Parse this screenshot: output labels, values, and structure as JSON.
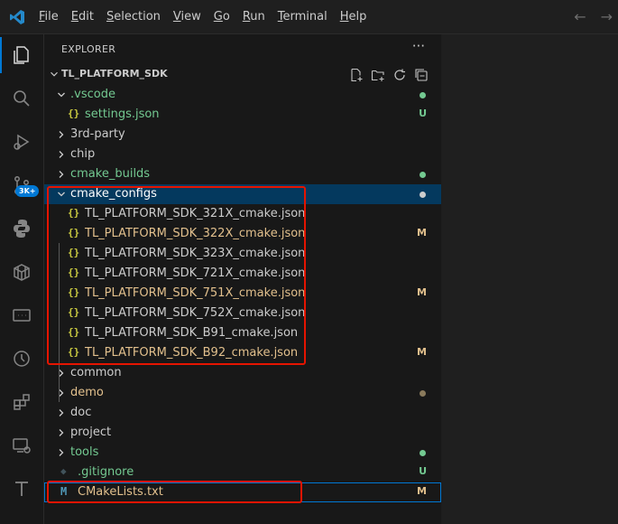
{
  "menu": [
    {
      "first": "F",
      "rest": "ile"
    },
    {
      "first": "E",
      "rest": "dit"
    },
    {
      "first": "S",
      "rest": "election"
    },
    {
      "first": "V",
      "rest": "iew"
    },
    {
      "first": "G",
      "rest": "o"
    },
    {
      "first": "R",
      "rest": "un"
    },
    {
      "first": "T",
      "rest": "erminal"
    },
    {
      "first": "H",
      "rest": "elp"
    }
  ],
  "nav": {
    "back": "←",
    "forward": "→"
  },
  "activity_bar": {
    "items": [
      "explorer-icon",
      "search-icon",
      "run-debug-icon",
      "source-control-icon",
      "python-icon",
      "package-icon",
      "remote-icon",
      "timeline-icon",
      "extensions-icon",
      "remote-explorer-icon",
      "text-icon"
    ],
    "badge": "3K+"
  },
  "explorer": {
    "header": "EXPLORER",
    "more": "···",
    "root": "TL_PLATFORM_SDK",
    "rows": [
      {
        "label": ".vscode",
        "type": "folder",
        "open": true,
        "indent": 0,
        "color": "#73c991",
        "decoration": "dot",
        "decoColor": "#73c991"
      },
      {
        "label": "settings.json",
        "type": "json",
        "indent": 1,
        "color": "#73c991",
        "decoration": "U",
        "decoColor": "#73c991"
      },
      {
        "label": "3rd-party",
        "type": "folder",
        "open": false,
        "indent": 0,
        "color": "#cccccc"
      },
      {
        "label": "chip",
        "type": "folder",
        "open": false,
        "indent": 0,
        "color": "#cccccc"
      },
      {
        "label": "cmake_builds",
        "type": "folder",
        "open": false,
        "indent": 0,
        "color": "#73c991",
        "decoration": "dot",
        "decoColor": "#73c991"
      },
      {
        "label": "cmake_configs",
        "type": "folder",
        "open": true,
        "indent": 0,
        "color": "#ffffff",
        "decoration": "dot",
        "decoColor": "#cccccc",
        "selected": true
      },
      {
        "label": "TL_PLATFORM_SDK_321X_cmake.json",
        "type": "json",
        "indent": 1,
        "color": "#cccccc"
      },
      {
        "label": "TL_PLATFORM_SDK_322X_cmake.json",
        "type": "json",
        "indent": 1,
        "color": "#e2c08d",
        "decoration": "M",
        "decoColor": "#e2c08d"
      },
      {
        "label": "TL_PLATFORM_SDK_323X_cmake.json",
        "type": "json",
        "indent": 1,
        "color": "#cccccc"
      },
      {
        "label": "TL_PLATFORM_SDK_721X_cmake.json",
        "type": "json",
        "indent": 1,
        "color": "#cccccc"
      },
      {
        "label": "TL_PLATFORM_SDK_751X_cmake.json",
        "type": "json",
        "indent": 1,
        "color": "#e2c08d",
        "decoration": "M",
        "decoColor": "#e2c08d"
      },
      {
        "label": "TL_PLATFORM_SDK_752X_cmake.json",
        "type": "json",
        "indent": 1,
        "color": "#cccccc"
      },
      {
        "label": "TL_PLATFORM_SDK_B91_cmake.json",
        "type": "json",
        "indent": 1,
        "color": "#cccccc"
      },
      {
        "label": "TL_PLATFORM_SDK_B92_cmake.json",
        "type": "json",
        "indent": 1,
        "color": "#e2c08d",
        "decoration": "M",
        "decoColor": "#e2c08d"
      },
      {
        "label": "common",
        "type": "folder",
        "open": false,
        "indent": 0,
        "color": "#cccccc"
      },
      {
        "label": "demo",
        "type": "folder",
        "open": false,
        "indent": 0,
        "color": "#e2c08d",
        "decoration": "dot",
        "decoColor": "#8a7a5c"
      },
      {
        "label": "doc",
        "type": "folder",
        "open": false,
        "indent": 0,
        "color": "#cccccc"
      },
      {
        "label": "project",
        "type": "folder",
        "open": false,
        "indent": 0,
        "color": "#cccccc"
      },
      {
        "label": "tools",
        "type": "folder",
        "open": false,
        "indent": 0,
        "color": "#73c991",
        "decoration": "dot",
        "decoColor": "#73c991"
      },
      {
        "label": ".gitignore",
        "type": "git",
        "indent": 0,
        "color": "#73c991",
        "decoration": "U",
        "decoColor": "#73c991"
      },
      {
        "label": "CMakeLists.txt",
        "type": "cmake",
        "indent": 0,
        "color": "#e2c08d",
        "decoration": "M",
        "decoColor": "#e2c08d",
        "focused": true
      }
    ]
  },
  "colors": {
    "accent": "#0078d4",
    "highlight": "#e51400",
    "modified": "#e2c08d",
    "untracked": "#73c991"
  }
}
